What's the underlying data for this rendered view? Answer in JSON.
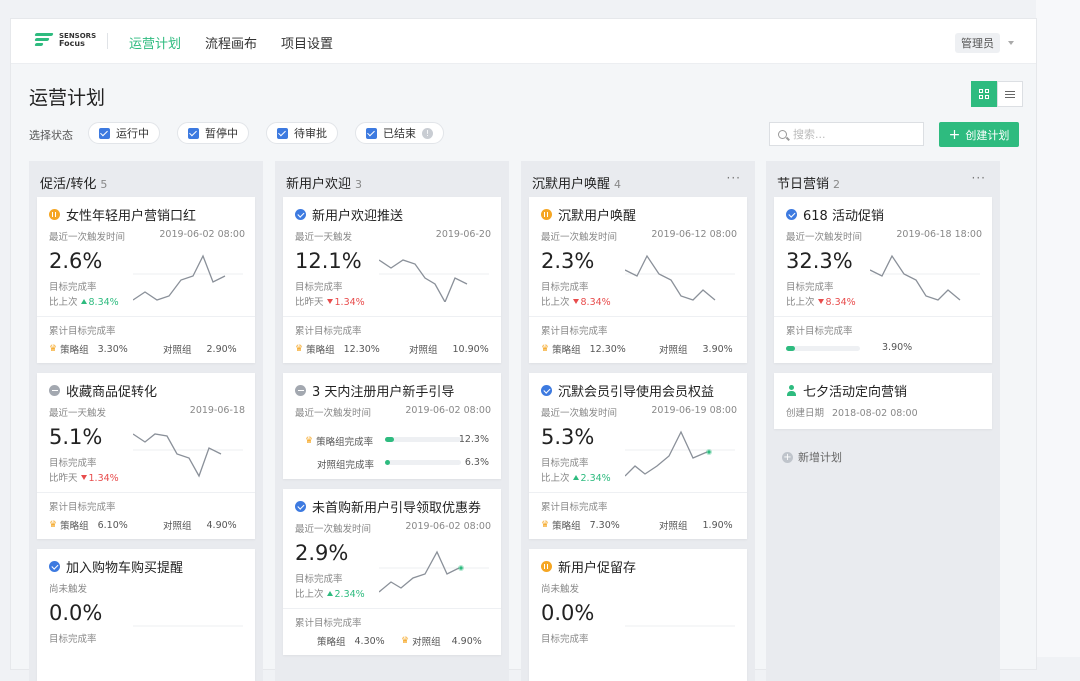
{
  "nav": {
    "logo_line1": "SENSORS",
    "logo_line2": "Focus",
    "items": [
      "运营计划",
      "流程画布",
      "项目设置"
    ],
    "user": "管理员"
  },
  "page": {
    "title": "运营计划",
    "filter_label": "选择状态",
    "chips": [
      "运行中",
      "暂停中",
      "待审批",
      "已结束"
    ],
    "search_placeholder": "搜索...",
    "create_label": "创建计划"
  },
  "columns": [
    {
      "title": "促活/转化",
      "count": "5",
      "cards": [
        {
          "title": "女性年轻用户营销口红",
          "meta": "最近一次触发时间",
          "time": "2019-06-02 08:00",
          "value": "2.6%",
          "target": "目标完成率",
          "cmp": "比上次",
          "delta": "8.34%",
          "cum": "累计目标完成率",
          "g1": "策略组",
          "g1v": "3.30%",
          "g2": "对照组",
          "g2v": "2.90%"
        },
        {
          "title": "收藏商品促转化",
          "meta": "最近一天触发",
          "time": "2019-06-18",
          "value": "5.1%",
          "target": "目标完成率",
          "cmp": "比昨天",
          "delta": "1.34%",
          "cum": "累计目标完成率",
          "g1": "策略组",
          "g1v": "6.10%",
          "g2": "对照组",
          "g2v": "4.90%"
        },
        {
          "title": "加入购物车购买提醒",
          "meta": "尚未触发",
          "value": "0.0%",
          "target": "目标完成率"
        }
      ]
    },
    {
      "title": "新用户欢迎",
      "count": "3",
      "cards": [
        {
          "title": "新用户欢迎推送",
          "meta": "最近一天触发",
          "time": "2019-06-20",
          "value": "12.1%",
          "target": "目标完成率",
          "cmp": "比昨天",
          "delta": "1.34%",
          "cum": "累计目标完成率",
          "g1": "策略组",
          "g1v": "12.30%",
          "g2": "对照组",
          "g2v": "10.90%"
        },
        {
          "title": "3 天内注册用户新手引导",
          "meta": "最近一次触发时间",
          "time": "2019-06-02 08:00",
          "p1": "策略组完成率",
          "p1v": "12.3%",
          "p1f": 0.123,
          "p2": "对照组完成率",
          "p2v": "6.3%",
          "p2f": 0.063
        },
        {
          "title": "未首购新用户引导领取优惠券",
          "meta": "最近一次触发时间",
          "time": "2019-06-02 08:00",
          "value": "2.9%",
          "target": "目标完成率",
          "cmp": "比上次",
          "delta": "2.34%",
          "cum": "累计目标完成率",
          "g1": "策略组",
          "g1v": "4.30%",
          "g2": "对照组",
          "g2v": "4.90%"
        }
      ]
    },
    {
      "title": "沉默用户唤醒",
      "count": "4",
      "more": "···",
      "cards": [
        {
          "title": "沉默用户唤醒",
          "meta": "最近一次触发时间",
          "time": "2019-06-12 08:00",
          "value": "2.3%",
          "target": "目标完成率",
          "cmp": "比上次",
          "delta": "8.34%",
          "cum": "累计目标完成率",
          "g1": "策略组",
          "g1v": "12.30%",
          "g2": "对照组",
          "g2v": "3.90%"
        },
        {
          "title": "沉默会员引导使用会员权益",
          "meta": "最近一次触发时间",
          "time": "2019-06-19 08:00",
          "value": "5.3%",
          "target": "目标完成率",
          "cmp": "比上次",
          "delta": "2.34%",
          "cum": "累计目标完成率",
          "g1": "策略组",
          "g1v": "7.30%",
          "g2": "对照组",
          "g2v": "1.90%"
        },
        {
          "title": "新用户促留存",
          "meta": "尚未触发",
          "value": "0.0%",
          "target": "目标完成率"
        }
      ]
    },
    {
      "title": "节日营销",
      "count": "2",
      "more": "···",
      "cards": [
        {
          "title": "618 活动促销",
          "meta": "最近一次触发时间",
          "time": "2019-06-18 18:00",
          "value": "32.3%",
          "target": "目标完成率",
          "cmp": "比上次",
          "delta": "8.34%",
          "cum": "累计目标完成率",
          "prog": 0.12,
          "progv": "3.90%"
        },
        {
          "title": "七夕活动定向营销",
          "meta": "创建日期",
          "time": "2018-08-02 08:00"
        }
      ],
      "add_plan": "新增计划"
    }
  ],
  "colors": {
    "brand": "#2ebb7f",
    "up": "#2ebb7f",
    "down": "#e84c4c",
    "check": "#3d7ae0",
    "paused": "#f5a623"
  }
}
